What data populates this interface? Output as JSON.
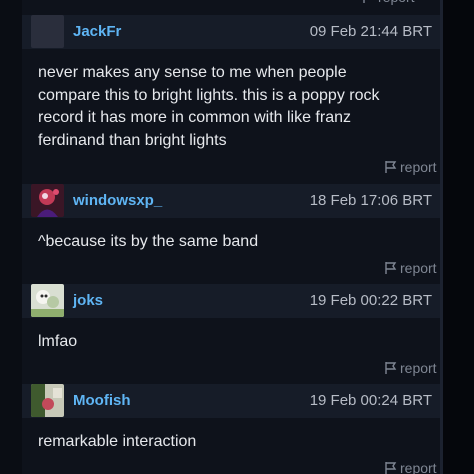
{
  "comments": [
    {
      "username": "JackFr",
      "timestamp": "09 Feb 21:44 BRT",
      "lines": [
        "never makes any sense to me when people",
        "compare this to bright lights. this is a poppy rock",
        "record it has more in common with like franz",
        "ferdinand than bright lights"
      ],
      "report_label": "report"
    },
    {
      "username": "windowsxp_",
      "timestamp": "18 Feb 17:06 BRT",
      "lines": [
        "^because its by the same band"
      ],
      "report_label": "report"
    },
    {
      "username": "joks",
      "timestamp": "19 Feb 00:22 BRT",
      "lines": [
        "lmfao"
      ],
      "report_label": "report"
    },
    {
      "username": "Moofish",
      "timestamp": "19 Feb 00:24 BRT",
      "lines": [
        "remarkable interaction"
      ],
      "report_label": "report"
    }
  ],
  "top_partial_report_label": "report",
  "colors": {
    "background": "#0a0d14",
    "comment_header": "#161c28",
    "username": "#5fb5f4",
    "timestamp": "#b7bcc6",
    "body_text": "#e6e8ec",
    "report_text": "#7f8693"
  },
  "icons": {
    "report": "flag-icon"
  }
}
